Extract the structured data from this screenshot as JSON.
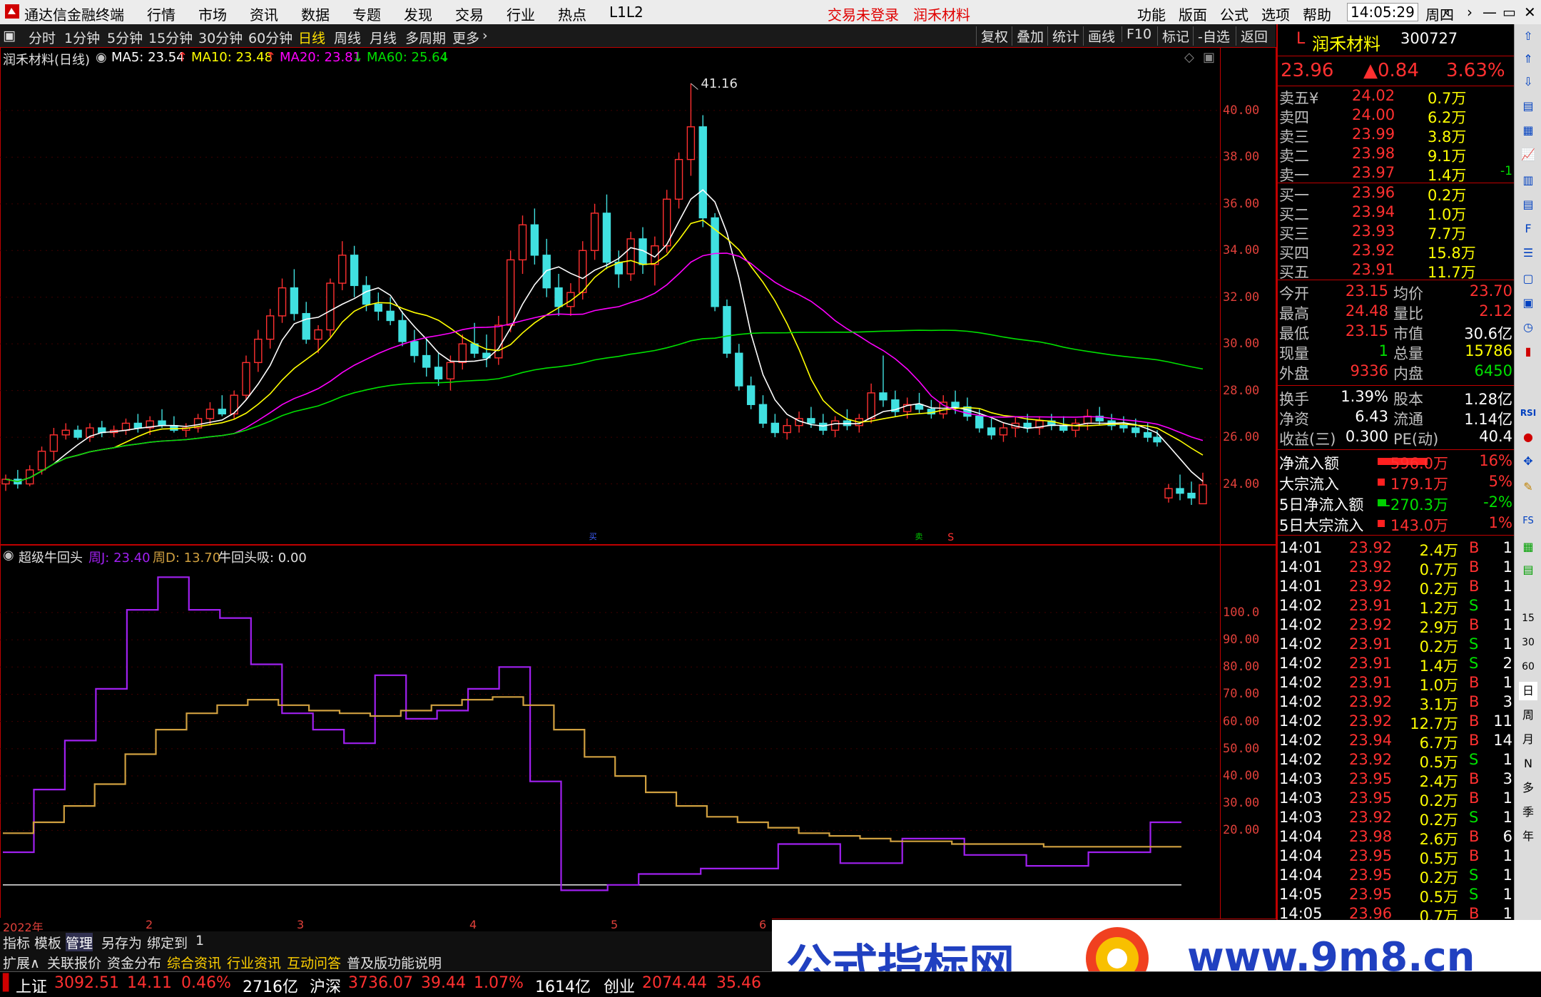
{
  "titlebar": {
    "app_title": "通达信金融终端",
    "menu": [
      "行情",
      "市场",
      "资讯",
      "数据",
      "专题",
      "发现",
      "交易",
      "行业",
      "热点",
      "L1L2"
    ],
    "trade_status": "交易未登录",
    "stock_name": "润禾材料",
    "right_menu": [
      "功能",
      "版面",
      "公式",
      "选项",
      "帮助"
    ],
    "time": "14:05:29",
    "weekday": "周四"
  },
  "toolbar": {
    "periods": [
      "分时",
      "1分钟",
      "5分钟",
      "15分钟",
      "30分钟",
      "60分钟",
      "日线",
      "周线",
      "月线",
      "多周期",
      "更多"
    ],
    "active_period": "日线",
    "buttons": [
      "复权",
      "叠加",
      "统计",
      "画线",
      "F10",
      "标记",
      "-自选",
      "返回"
    ]
  },
  "main_chart": {
    "title": "润禾材料(日线)",
    "ma5": "MA5: 23.54",
    "ma10": "MA10: 23.48",
    "ma20": "MA20: 23.81",
    "ma60": "MA60: 25.64",
    "peak_label": "41.16",
    "marker_b": "买",
    "marker_s": "S",
    "marker_w": "卖"
  },
  "sub_chart": {
    "title": "超级牛回头",
    "zhou_j": "周J: 23.40",
    "zhou_d": "周D: 13.70",
    "niu": "牛回头吸: 0.00"
  },
  "colors": {
    "ma5": "#ffffff",
    "ma10": "#ffff00",
    "ma20": "#ff00ff",
    "ma60": "#00e000",
    "up": "#ff3030",
    "down": "#40e0e0",
    "j_line": "#a020f0",
    "d_line": "#d0a040"
  },
  "x_axis": [
    "2022年",
    "2",
    "3",
    "4",
    "5",
    "6"
  ],
  "quote": {
    "code": "300727",
    "name": "润禾材料",
    "prefix": "L",
    "price": "23.96",
    "change": "▲0.84",
    "pct": "3.63%",
    "asks": [
      {
        "label": "卖五¥",
        "price": "24.02",
        "vol": "0.7万",
        "chg": ""
      },
      {
        "label": "卖四",
        "price": "24.00",
        "vol": "6.2万",
        "chg": ""
      },
      {
        "label": "卖三",
        "price": "23.99",
        "vol": "3.8万",
        "chg": ""
      },
      {
        "label": "卖二",
        "price": "23.98",
        "vol": "9.1万",
        "chg": ""
      },
      {
        "label": "卖一",
        "price": "23.97",
        "vol": "1.4万",
        "chg": "-1"
      }
    ],
    "bids": [
      {
        "label": "买一",
        "price": "23.96",
        "vol": "0.2万"
      },
      {
        "label": "买二",
        "price": "23.94",
        "vol": "1.0万"
      },
      {
        "label": "买三",
        "price": "23.93",
        "vol": "7.7万"
      },
      {
        "label": "买四",
        "price": "23.92",
        "vol": "15.8万"
      },
      {
        "label": "买五",
        "price": "23.91",
        "vol": "11.7万"
      }
    ],
    "stats1": [
      {
        "l1": "今开",
        "v1": "23.15",
        "l2": "均价",
        "v2": "23.70"
      },
      {
        "l1": "最高",
        "v1": "24.48",
        "l2": "量比",
        "v2": "2.12"
      },
      {
        "l1": "最低",
        "v1": "23.15",
        "l2": "市值",
        "v2": "30.6亿"
      },
      {
        "l1": "现量",
        "v1": "1",
        "l2": "总量",
        "v2": "15786"
      },
      {
        "l1": "外盘",
        "v1": "9336",
        "l2": "内盘",
        "v2": "6450"
      }
    ],
    "stats2": [
      {
        "l1": "换手",
        "v1": "1.39%",
        "l2": "股本",
        "v2": "1.28亿"
      },
      {
        "l1": "净资",
        "v1": "6.43",
        "l2": "流通",
        "v2": "1.14亿"
      },
      {
        "l1": "收益(三)",
        "v1": "0.300",
        "l2": "PE(动)",
        "v2": "40.4"
      }
    ],
    "flows": [
      {
        "label": "净流入额",
        "value": "596.0万",
        "pct": "16%"
      },
      {
        "label": "大宗流入",
        "value": "179.1万",
        "pct": "5%"
      },
      {
        "label": "5日净流入额",
        "value": "-270.3万",
        "pct": "-2%"
      },
      {
        "label": "5日大宗流入",
        "value": "143.0万",
        "pct": "1%"
      }
    ],
    "ticks": [
      {
        "t": "14:01",
        "p": "23.92",
        "v": "2.4万",
        "s": "B",
        "n": "1"
      },
      {
        "t": "14:01",
        "p": "23.92",
        "v": "0.7万",
        "s": "B",
        "n": "1"
      },
      {
        "t": "14:01",
        "p": "23.92",
        "v": "0.2万",
        "s": "B",
        "n": "1"
      },
      {
        "t": "14:02",
        "p": "23.91",
        "v": "1.2万",
        "s": "S",
        "n": "1"
      },
      {
        "t": "14:02",
        "p": "23.92",
        "v": "2.9万",
        "s": "B",
        "n": "1"
      },
      {
        "t": "14:02",
        "p": "23.91",
        "v": "0.2万",
        "s": "S",
        "n": "1"
      },
      {
        "t": "14:02",
        "p": "23.91",
        "v": "1.4万",
        "s": "S",
        "n": "2"
      },
      {
        "t": "14:02",
        "p": "23.91",
        "v": "1.0万",
        "s": "B",
        "n": "1"
      },
      {
        "t": "14:02",
        "p": "23.92",
        "v": "3.1万",
        "s": "B",
        "n": "3"
      },
      {
        "t": "14:02",
        "p": "23.92",
        "v": "12.7万",
        "s": "B",
        "n": "11"
      },
      {
        "t": "14:02",
        "p": "23.94",
        "v": "6.7万",
        "s": "B",
        "n": "14"
      },
      {
        "t": "14:02",
        "p": "23.92",
        "v": "0.5万",
        "s": "S",
        "n": "1"
      },
      {
        "t": "14:03",
        "p": "23.95",
        "v": "2.4万",
        "s": "B",
        "n": "3"
      },
      {
        "t": "14:03",
        "p": "23.95",
        "v": "0.2万",
        "s": "B",
        "n": "1"
      },
      {
        "t": "14:03",
        "p": "23.92",
        "v": "0.2万",
        "s": "S",
        "n": "1"
      },
      {
        "t": "14:04",
        "p": "23.98",
        "v": "2.6万",
        "s": "B",
        "n": "6"
      },
      {
        "t": "14:04",
        "p": "23.95",
        "v": "0.5万",
        "s": "B",
        "n": "1"
      },
      {
        "t": "14:04",
        "p": "23.95",
        "v": "0.2万",
        "s": "S",
        "n": "1"
      },
      {
        "t": "14:05",
        "p": "23.95",
        "v": "0.5万",
        "s": "S",
        "n": "1"
      },
      {
        "t": "14:05",
        "p": "23.96",
        "v": "0.7万",
        "s": "B",
        "n": "1"
      }
    ]
  },
  "sidebar_labels": [
    "RSI",
    "FS",
    "15",
    "30",
    "60",
    "日",
    "周",
    "月",
    "N",
    "多",
    "季",
    "年"
  ],
  "bottom": {
    "row1": [
      "指标",
      "模板",
      "管理",
      "另存为",
      "绑定到",
      "1"
    ],
    "row2": [
      "扩展∧",
      "关联报价",
      "资金分布",
      "综合资讯",
      "行业资讯",
      "互动问答",
      "普及版功能说明"
    ]
  },
  "status": {
    "sh_label": "上证",
    "sh_val": "3092.51",
    "sh_chg": "14.11",
    "sh_pct": "0.46%",
    "sh_amt": "2716亿",
    "sz_label": "沪深",
    "sz_val": "3736.07",
    "sz_chg": "39.44",
    "sz_pct": "1.07%",
    "sz_amt": "1614亿",
    "cy_label": "创业",
    "cy_val": "2074.44",
    "cy_chg": "35.46"
  },
  "watermark": {
    "text1": "公式指标网",
    "text2": "www.9m8.cn"
  },
  "chart_data": [
    {
      "type": "candlestick",
      "name_ref": "main_chart",
      "y_ticks": [
        24.0,
        26.0,
        28.0,
        30.0,
        32.0,
        34.0,
        36.0,
        38.0,
        40.0
      ],
      "ylim": [
        22.0,
        41.8
      ],
      "ohlc": [
        [
          24.0,
          24.4,
          23.7,
          24.2
        ],
        [
          24.2,
          24.6,
          23.8,
          24.0
        ],
        [
          24.0,
          24.8,
          23.9,
          24.6
        ],
        [
          24.6,
          25.6,
          24.4,
          25.4
        ],
        [
          25.4,
          26.4,
          25.0,
          26.1
        ],
        [
          26.1,
          26.6,
          25.9,
          26.3
        ],
        [
          26.3,
          26.5,
          25.9,
          26.0
        ],
        [
          26.0,
          26.6,
          25.8,
          26.4
        ],
        [
          26.4,
          26.7,
          26.0,
          26.2
        ],
        [
          26.2,
          26.5,
          26.0,
          26.3
        ],
        [
          26.3,
          26.8,
          26.1,
          26.6
        ],
        [
          26.6,
          27.0,
          26.2,
          26.4
        ],
        [
          26.4,
          26.9,
          26.1,
          26.7
        ],
        [
          26.7,
          27.2,
          26.4,
          26.5
        ],
        [
          26.5,
          26.9,
          26.2,
          26.3
        ],
        [
          26.3,
          26.6,
          26.0,
          26.4
        ],
        [
          26.4,
          27.0,
          26.2,
          26.8
        ],
        [
          26.8,
          27.5,
          26.5,
          27.2
        ],
        [
          27.2,
          27.8,
          26.9,
          27.0
        ],
        [
          27.0,
          28.0,
          26.8,
          27.8
        ],
        [
          27.8,
          29.5,
          27.6,
          29.2
        ],
        [
          29.2,
          30.6,
          28.8,
          30.2
        ],
        [
          30.2,
          31.5,
          29.8,
          31.2
        ],
        [
          31.2,
          32.8,
          30.9,
          32.4
        ],
        [
          32.4,
          33.2,
          31.0,
          31.3
        ],
        [
          31.3,
          31.8,
          30.0,
          30.2
        ],
        [
          30.2,
          30.8,
          29.6,
          30.6
        ],
        [
          30.6,
          32.8,
          30.3,
          32.6
        ],
        [
          32.6,
          34.4,
          32.3,
          33.8
        ],
        [
          33.8,
          34.2,
          32.0,
          32.5
        ],
        [
          32.5,
          32.9,
          31.4,
          31.7
        ],
        [
          31.7,
          32.2,
          31.0,
          31.4
        ],
        [
          31.4,
          32.0,
          30.8,
          31.0
        ],
        [
          31.0,
          31.4,
          29.9,
          30.1
        ],
        [
          30.1,
          30.6,
          29.2,
          29.5
        ],
        [
          29.5,
          30.2,
          28.6,
          29.0
        ],
        [
          29.0,
          29.6,
          28.2,
          28.5
        ],
        [
          28.5,
          29.5,
          28.0,
          29.2
        ],
        [
          29.2,
          30.4,
          28.9,
          30.0
        ],
        [
          30.0,
          30.9,
          29.4,
          29.6
        ],
        [
          29.6,
          30.4,
          29.0,
          29.4
        ],
        [
          29.4,
          31.2,
          29.1,
          30.8
        ],
        [
          30.8,
          34.0,
          30.5,
          33.6
        ],
        [
          33.6,
          35.5,
          33.0,
          35.1
        ],
        [
          35.1,
          35.8,
          33.4,
          33.8
        ],
        [
          33.8,
          34.5,
          32.0,
          32.4
        ],
        [
          32.4,
          33.0,
          31.2,
          31.6
        ],
        [
          31.6,
          32.6,
          31.2,
          32.2
        ],
        [
          32.2,
          34.4,
          31.9,
          34.0
        ],
        [
          34.0,
          36.0,
          33.6,
          35.6
        ],
        [
          35.6,
          36.4,
          33.2,
          33.5
        ],
        [
          33.5,
          34.0,
          32.4,
          33.0
        ],
        [
          33.0,
          34.8,
          32.7,
          34.5
        ],
        [
          34.5,
          35.0,
          33.0,
          33.4
        ],
        [
          33.4,
          34.6,
          32.5,
          34.2
        ],
        [
          34.2,
          36.6,
          33.9,
          36.2
        ],
        [
          36.2,
          38.2,
          35.8,
          37.9
        ],
        [
          37.9,
          41.16,
          37.2,
          39.3
        ],
        [
          39.3,
          39.8,
          35.0,
          35.4
        ],
        [
          35.4,
          35.6,
          31.4,
          31.6
        ],
        [
          31.6,
          31.9,
          29.4,
          29.6
        ],
        [
          29.6,
          30.0,
          28.0,
          28.2
        ],
        [
          28.2,
          28.6,
          27.2,
          27.4
        ],
        [
          27.4,
          27.8,
          26.4,
          26.6
        ],
        [
          26.6,
          27.0,
          26.0,
          26.2
        ],
        [
          26.2,
          26.8,
          25.9,
          26.5
        ],
        [
          26.5,
          27.1,
          26.2,
          26.8
        ],
        [
          26.8,
          27.3,
          26.4,
          26.6
        ],
        [
          26.6,
          27.0,
          26.1,
          26.3
        ],
        [
          26.3,
          26.9,
          26.0,
          26.7
        ],
        [
          26.7,
          27.2,
          26.3,
          26.5
        ],
        [
          26.5,
          27.0,
          26.2,
          26.8
        ],
        [
          26.8,
          28.3,
          26.6,
          27.9
        ],
        [
          27.9,
          29.5,
          27.3,
          27.6
        ],
        [
          27.6,
          28.0,
          26.9,
          27.1
        ],
        [
          27.1,
          27.7,
          26.8,
          27.4
        ],
        [
          27.4,
          27.9,
          27.0,
          27.2
        ],
        [
          27.2,
          27.6,
          26.8,
          27.0
        ],
        [
          27.0,
          27.8,
          26.8,
          27.5
        ],
        [
          27.5,
          28.0,
          27.0,
          27.3
        ],
        [
          27.3,
          27.7,
          26.7,
          26.9
        ],
        [
          26.9,
          27.2,
          26.2,
          26.4
        ],
        [
          26.4,
          26.8,
          25.9,
          26.1
        ],
        [
          26.1,
          26.6,
          25.8,
          26.4
        ],
        [
          26.4,
          26.9,
          26.0,
          26.6
        ],
        [
          26.6,
          27.0,
          26.2,
          26.4
        ],
        [
          26.4,
          26.9,
          26.1,
          26.7
        ],
        [
          26.7,
          27.0,
          26.3,
          26.5
        ],
        [
          26.5,
          26.9,
          26.2,
          26.3
        ],
        [
          26.3,
          26.8,
          26.0,
          26.6
        ],
        [
          26.6,
          27.2,
          26.3,
          26.9
        ],
        [
          26.9,
          27.3,
          26.5,
          26.7
        ],
        [
          26.7,
          27.0,
          26.3,
          26.5
        ],
        [
          26.5,
          26.9,
          26.2,
          26.4
        ],
        [
          26.4,
          26.8,
          26.0,
          26.2
        ],
        [
          26.2,
          26.6,
          25.8,
          26.0
        ],
        [
          26.0,
          26.3,
          25.6,
          25.8
        ],
        [
          23.4,
          24.0,
          23.2,
          23.8
        ],
        [
          23.8,
          24.4,
          23.3,
          23.6
        ],
        [
          23.6,
          24.1,
          23.1,
          23.4
        ],
        [
          23.15,
          24.48,
          23.15,
          23.96
        ]
      ]
    },
    {
      "type": "line",
      "name_ref": "sub_chart",
      "y_ticks": [
        20.0,
        30.0,
        40.0,
        50.0,
        60.0,
        70.0,
        80.0,
        90.0,
        100.0
      ],
      "ylim": [
        -10,
        117
      ],
      "series": [
        {
          "name": "周J",
          "values": [
            12,
            12,
            35,
            35,
            53,
            53,
            72,
            72,
            101,
            101,
            113,
            113,
            101,
            101,
            98,
            98,
            81,
            81,
            63,
            63,
            57,
            57,
            52,
            52,
            77,
            77,
            61,
            61,
            64,
            64,
            72,
            72,
            80,
            80,
            38,
            38,
            -2,
            -2,
            -2,
            0,
            0,
            4,
            4,
            4,
            4,
            6,
            6,
            6,
            6,
            6,
            15,
            15,
            15,
            15,
            8,
            8,
            8,
            8,
            17,
            17,
            17,
            17,
            11,
            11,
            11,
            11,
            7,
            7,
            7,
            7,
            12,
            12,
            12,
            12,
            23,
            23,
            23
          ]
        },
        {
          "name": "周D",
          "values": [
            19,
            19,
            23,
            23,
            29,
            29,
            37,
            37,
            48,
            48,
            57,
            57,
            63,
            63,
            66,
            66,
            68,
            68,
            66,
            66,
            64,
            64,
            63,
            63,
            62,
            62,
            64,
            64,
            66,
            66,
            68,
            68,
            69,
            69,
            66,
            66,
            57,
            57,
            47,
            47,
            40,
            40,
            34,
            34,
            29,
            29,
            25,
            25,
            23,
            23,
            21,
            21,
            19,
            19,
            18,
            18,
            17,
            17,
            16,
            16,
            16,
            16,
            15,
            15,
            15,
            15,
            15,
            15,
            14,
            14,
            14,
            14,
            14,
            14,
            14,
            14,
            14,
            14
          ]
        }
      ]
    }
  ]
}
